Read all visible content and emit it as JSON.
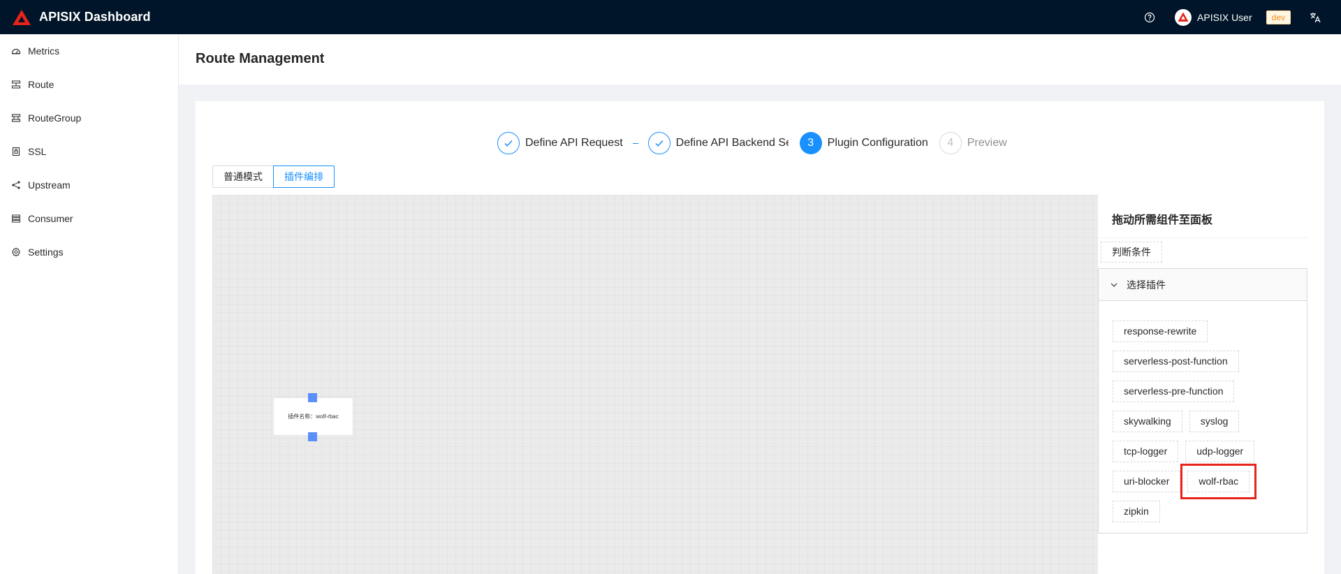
{
  "header": {
    "title": "APISIX Dashboard",
    "username": "APISIX User",
    "env": "dev",
    "icons": [
      "apisix-logo-icon",
      "help-icon",
      "user-avatar-icon",
      "translate-icon"
    ]
  },
  "sidebar": {
    "items": [
      {
        "label": "Metrics",
        "icon": "dashboard-icon"
      },
      {
        "label": "Route",
        "icon": "route-icon"
      },
      {
        "label": "RouteGroup",
        "icon": "route-group-icon"
      },
      {
        "label": "SSL",
        "icon": "ssl-icon"
      },
      {
        "label": "Upstream",
        "icon": "upstream-icon"
      },
      {
        "label": "Consumer",
        "icon": "consumer-icon"
      },
      {
        "label": "Settings",
        "icon": "settings-icon"
      }
    ]
  },
  "page": {
    "title": "Route Management"
  },
  "steps": [
    {
      "number": "1",
      "label": "Define API Request",
      "status": "finish"
    },
    {
      "number": "2",
      "label": "Define API Backend Se",
      "status": "finish"
    },
    {
      "number": "3",
      "label": "Plugin Configuration",
      "status": "process"
    },
    {
      "number": "4",
      "label": "Preview",
      "status": "wait"
    }
  ],
  "mode": {
    "normal": "普通模式",
    "orchestration": "插件编排",
    "active": "orchestration"
  },
  "canvas": {
    "node_label": "插件名称：wolf-rbac"
  },
  "panel": {
    "title": "拖动所需组件至面板",
    "condition": "判断条件",
    "collapse_title": "选择插件",
    "plugins": [
      "response-rewrite",
      "serverless-post-function",
      "serverless-pre-function",
      "skywalking",
      "syslog",
      "tcp-logger",
      "udp-logger",
      "uri-blocker",
      "wolf-rbac",
      "zipkin"
    ],
    "highlighted_plugin": "wolf-rbac"
  },
  "colors": {
    "header_bg": "#001529",
    "primary": "#1890ff",
    "highlight": "#e8231a"
  }
}
